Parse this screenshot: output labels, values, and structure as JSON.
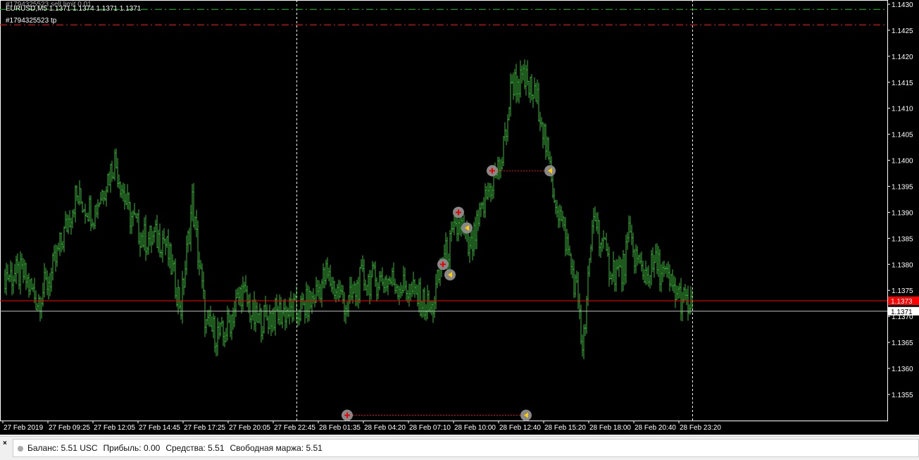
{
  "header": {
    "order_label": "#1794325523 sell limit 0.01",
    "symbol_line": "EURUSD,M5  1.1371 1.1374 1.1371 1.1371",
    "tp_label": "#1794325523 tp"
  },
  "price_axis": {
    "ticks": [
      "1.1430",
      "1.1425",
      "1.1420",
      "1.1415",
      "1.1410",
      "1.1405",
      "1.1400",
      "1.1395",
      "1.1390",
      "1.1385",
      "1.1380",
      "1.1375",
      "1.1370",
      "1.1365",
      "1.1360",
      "1.1355"
    ],
    "bid_label": "1.1373",
    "last_label": "1.1371"
  },
  "time_axis": {
    "ticks": [
      "27 Feb 2019",
      "27 Feb 09:25",
      "27 Feb 12:05",
      "27 Feb 14:45",
      "27 Feb 17:25",
      "27 Feb 20:05",
      "27 Feb 22:45",
      "28 Feb 01:35",
      "28 Feb 04:20",
      "28 Feb 07:10",
      "28 Feb 10:00",
      "28 Feb 12:40",
      "28 Feb 15:20",
      "28 Feb 18:00",
      "28 Feb 20:40",
      "28 Feb 23:20"
    ]
  },
  "colors": {
    "bars": "#3cb43c",
    "bid": "#ff0000",
    "ask": "#c0c0c0",
    "sell_limit": "#00c000",
    "tp": "#ff0000"
  },
  "chart_data": {
    "type": "ohlc",
    "symbol": "EURUSD",
    "timeframe": "M5",
    "ylim": [
      1.1352,
      1.1432
    ],
    "anchor_bar_index": [
      2,
      15,
      25,
      35,
      52,
      65,
      80,
      90,
      100,
      115,
      127,
      135,
      145,
      157,
      170,
      180,
      200,
      210,
      220,
      230,
      245,
      255,
      275,
      290,
      305,
      312,
      325,
      332,
      345,
      355,
      362,
      372,
      382,
      390,
      400,
      410,
      412,
      420,
      430,
      440,
      445,
      455,
      465,
      477,
      490
    ],
    "anchor_close": [
      1.1378,
      1.1378,
      1.1373,
      1.1378,
      1.1393,
      1.139,
      1.14,
      1.139,
      1.1385,
      1.1385,
      1.1372,
      1.1392,
      1.1368,
      1.1366,
      1.1375,
      1.1369,
      1.1371,
      1.1371,
      1.1373,
      1.1378,
      1.1372,
      1.1377,
      1.1377,
      1.1375,
      1.1371,
      1.138,
      1.1388,
      1.1382,
      1.1394,
      1.14,
      1.1415,
      1.1415,
      1.141,
      1.1396,
      1.1385,
      1.1372,
      1.1362,
      1.139,
      1.138,
      1.1378,
      1.1385,
      1.1378,
      1.138,
      1.1375,
      1.1371
    ],
    "levels": {
      "sell_limit": 1.1429,
      "tp": 1.1426,
      "bid": 1.1373,
      "last": 1.1371
    },
    "trades": [
      {
        "open_bar": 348,
        "open_price": 1.1398,
        "close_bar": 389,
        "close_price": 1.1398
      },
      {
        "open_bar": 245,
        "open_price": 1.1351,
        "close_bar": 372,
        "close_price": 1.1351
      }
    ],
    "markers": [
      {
        "bar": 324,
        "price": 1.139,
        "kind": "open"
      },
      {
        "bar": 330,
        "price": 1.1387,
        "kind": "close"
      },
      {
        "bar": 313,
        "price": 1.138,
        "kind": "open"
      },
      {
        "bar": 318,
        "price": 1.1378,
        "kind": "close"
      }
    ],
    "separators_bar": [
      209,
      490
    ]
  },
  "status": {
    "balance": "Баланс: 5.51 USC",
    "profit": "Прибыль: 0.00",
    "equity": "Средства: 5.51",
    "free_margin": "Свободная маржа: 5.51",
    "close": "×"
  }
}
